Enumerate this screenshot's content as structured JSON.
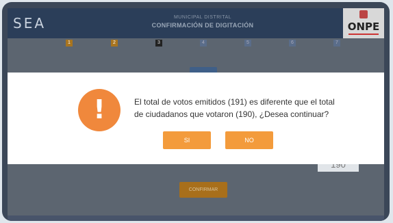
{
  "header": {
    "logo": "SEA",
    "subtitle": "MUNICIPAL DISTRITAL",
    "title": "CONFIRMACIÓN DE DIGITACIÓN",
    "brand": "ONPE"
  },
  "steps": [
    "1",
    "2",
    "3",
    "4",
    "5",
    "6",
    "7"
  ],
  "dialog": {
    "icon": "warning-icon",
    "message_line1": "El total de votos emitidos (191) es diferente que el total",
    "message_line2": "de ciudadanos que votaron (190), ¿Desea continuar?",
    "yes_label": "SI",
    "no_label": "NO"
  },
  "background": {
    "count_value": "190",
    "confirm_label": "CONFIRMAR"
  },
  "colors": {
    "accent": "#f39b3c",
    "warning": "#f0883c",
    "header": "#2b3e59"
  }
}
